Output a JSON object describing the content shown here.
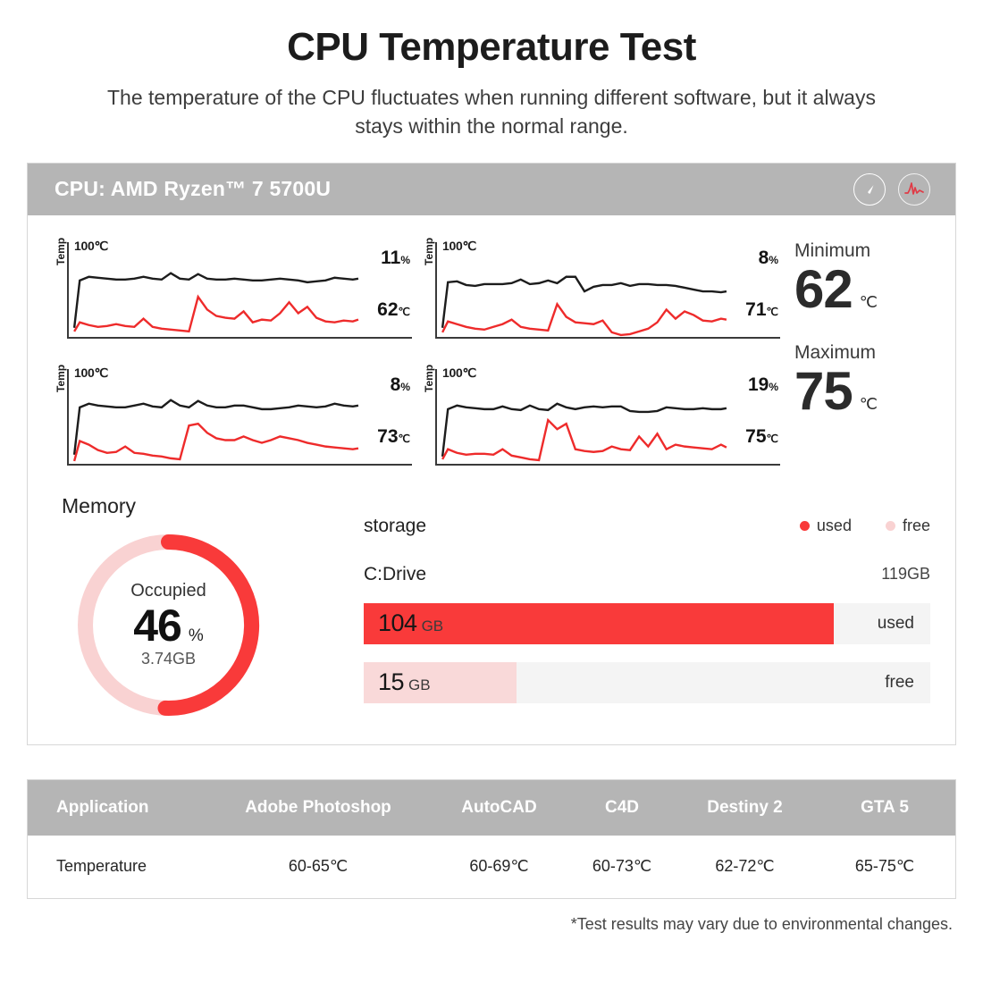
{
  "header": {
    "title": "CPU Temperature Test",
    "subtitle": "The temperature of the CPU fluctuates when running different software, but it always stays within the normal range."
  },
  "card": {
    "cpu_label": "CPU: AMD Ryzen™ 7 5700U",
    "icons": [
      {
        "name": "gauge-icon"
      },
      {
        "name": "pulse-icon"
      }
    ]
  },
  "charts": [
    {
      "axis_max": "100℃",
      "y_label": "Temp",
      "usage": "11",
      "usage_unit": "%",
      "temp": "62",
      "temp_unit": "℃"
    },
    {
      "axis_max": "100℃",
      "y_label": "Temp",
      "usage": "8",
      "usage_unit": "%",
      "temp": "71",
      "temp_unit": "℃"
    },
    {
      "axis_max": "100℃",
      "y_label": "Temp",
      "usage": "8",
      "usage_unit": "%",
      "temp": "73",
      "temp_unit": "℃"
    },
    {
      "axis_max": "100℃",
      "y_label": "Temp",
      "usage": "19",
      "usage_unit": "%",
      "temp": "75",
      "temp_unit": "℃"
    }
  ],
  "stats": {
    "minimum": {
      "label": "Minimum",
      "value": "62",
      "unit": "℃"
    },
    "maximum": {
      "label": "Maximum",
      "value": "75",
      "unit": "℃"
    }
  },
  "memory": {
    "title": "Memory",
    "occupied_label": "Occupied",
    "occupied_percent": "46",
    "percent_sign": "%",
    "occupied_size": "3.74GB"
  },
  "storage": {
    "title": "storage",
    "legend": [
      {
        "label": "used",
        "color": "#f93a3a"
      },
      {
        "label": "free",
        "color": "#f9d2d2"
      }
    ],
    "drive_name": "C:Drive",
    "drive_size": "119GB",
    "bars": [
      {
        "value": "104",
        "unit": "GB",
        "tag": "used",
        "percent": 83
      },
      {
        "value": "15",
        "unit": "GB",
        "tag": "free",
        "percent": 27
      }
    ]
  },
  "table": {
    "headers": [
      "Application",
      "Adobe Photoshop",
      "AutoCAD",
      "C4D",
      "Destiny 2",
      "GTA 5"
    ],
    "rows": [
      [
        "Temperature",
        "60-65℃",
        "60-69℃",
        "60-73℃",
        "62-72℃",
        "65-75℃"
      ]
    ]
  },
  "footnote": "*Test results may vary due to environmental changes.",
  "colors": {
    "accent_red": "#f93a3a",
    "light_pink": "#f9d2d2",
    "header_gray": "#b5b5b5"
  },
  "chart_data": {
    "type": "line",
    "title": "CPU Temperature Test",
    "xlabel": "",
    "ylabel": "Temp",
    "ylim": [
      0,
      100
    ],
    "grid": false,
    "legend": [
      "used",
      "free"
    ],
    "panels": [
      {
        "name": "panel-1",
        "axis_max": 100,
        "cpu_usage_percent": 11,
        "temperature_c": 62,
        "series": [
          {
            "name": "temp-black",
            "color": "#1c1c1c",
            "values": [
              14,
              62,
              66,
              65,
              64,
              63,
              63,
              64,
              66,
              64,
              63,
              68,
              64,
              63,
              67,
              64,
              63,
              63,
              64,
              63,
              62,
              62,
              63,
              64,
              63,
              62,
              60,
              61,
              62,
              65,
              64,
              63,
              64
            ]
          },
          {
            "name": "temp-red",
            "color": "#ee2b2b",
            "values": [
              10,
              18,
              15,
              13,
              14,
              16,
              14,
              13,
              20,
              13,
              11,
              10,
              9,
              8,
              42,
              30,
              24,
              22,
              21,
              28,
              18,
              20,
              19,
              26,
              34,
              24,
              30,
              20,
              17,
              16,
              18,
              17,
              19
            ]
          }
        ]
      },
      {
        "name": "panel-2",
        "axis_max": 100,
        "cpu_usage_percent": 8,
        "temperature_c": 71,
        "series": [
          {
            "name": "temp-black",
            "color": "#1c1c1c",
            "values": [
              14,
              60,
              61,
              57,
              56,
              58,
              58,
              58,
              59,
              63,
              58,
              59,
              62,
              59,
              66,
              66,
              50,
              55,
              57,
              57,
              59,
              56,
              58,
              58,
              57,
              57,
              56,
              54,
              52,
              50,
              50,
              49,
              50
            ]
          },
          {
            "name": "temp-red",
            "color": "#ee2b2b",
            "values": [
              8,
              20,
              17,
              14,
              12,
              11,
              14,
              17,
              22,
              14,
              12,
              11,
              10,
              38,
              24,
              18,
              17,
              16,
              20,
              8,
              5,
              6,
              9,
              12,
              18,
              30,
              20,
              28,
              24,
              18,
              17,
              20,
              19
            ]
          }
        ]
      },
      {
        "name": "panel-3",
        "axis_max": 100,
        "cpu_usage_percent": 8,
        "temperature_c": 73,
        "series": [
          {
            "name": "temp-black",
            "color": "#1c1c1c",
            "values": [
              14,
              62,
              66,
              64,
              63,
              62,
              62,
              64,
              66,
              63,
              62,
              68,
              64,
              62,
              67,
              64,
              62,
              62,
              64,
              64,
              62,
              60,
              60,
              61,
              62,
              64,
              63,
              62,
              63,
              66,
              64,
              63,
              64
            ]
          },
          {
            "name": "temp-red",
            "color": "#ee2b2b",
            "values": [
              6,
              26,
              22,
              16,
              13,
              14,
              20,
              14,
              13,
              11,
              10,
              8,
              7,
              40,
              42,
              34,
              28,
              26,
              26,
              30,
              26,
              24,
              26,
              30,
              28,
              26,
              24,
              22,
              20,
              19,
              18,
              17,
              18
            ]
          }
        ]
      },
      {
        "name": "panel-4",
        "axis_max": 100,
        "cpu_usage_percent": 19,
        "temperature_c": 75,
        "series": [
          {
            "name": "temp-black",
            "color": "#1c1c1c",
            "values": [
              12,
              60,
              64,
              62,
              61,
              60,
              60,
              63,
              60,
              59,
              64,
              60,
              59,
              66,
              62,
              60,
              62,
              63,
              62,
              63,
              63,
              58,
              57,
              57,
              58,
              62,
              61,
              60,
              60,
              61,
              60,
              60,
              61
            ]
          },
          {
            "name": "temp-red",
            "color": "#ee2b2b",
            "values": [
              8,
              20,
              16,
              13,
              15,
              14,
              13,
              20,
              12,
              10,
              8,
              7,
              46,
              38,
              42,
              20,
              17,
              16,
              17,
              22,
              20,
              18,
              30,
              22,
              32,
              20,
              24,
              22,
              21,
              20,
              19,
              24,
              20
            ]
          }
        ]
      }
    ],
    "memory_donut": {
      "type": "pie",
      "labels": [
        "Occupied",
        "Free"
      ],
      "values": [
        46,
        54
      ],
      "colors": [
        "#f93a3a",
        "#f9d2d2"
      ],
      "center_text": "46 %",
      "center_sub": "3.74GB"
    },
    "storage_bars": {
      "type": "bar",
      "categories": [
        "used",
        "free"
      ],
      "values": [
        104,
        15
      ],
      "unit": "GB",
      "total": 119,
      "colors": [
        "#f93a3a",
        "#f9d9d9"
      ]
    },
    "temperature_table": {
      "type": "table",
      "columns": [
        "Application",
        "Adobe Photoshop",
        "AutoCAD",
        "C4D",
        "Destiny 2",
        "GTA 5"
      ],
      "rows": [
        [
          "Temperature",
          "60-65℃",
          "60-69℃",
          "60-73℃",
          "62-72℃",
          "65-75℃"
        ]
      ]
    }
  }
}
